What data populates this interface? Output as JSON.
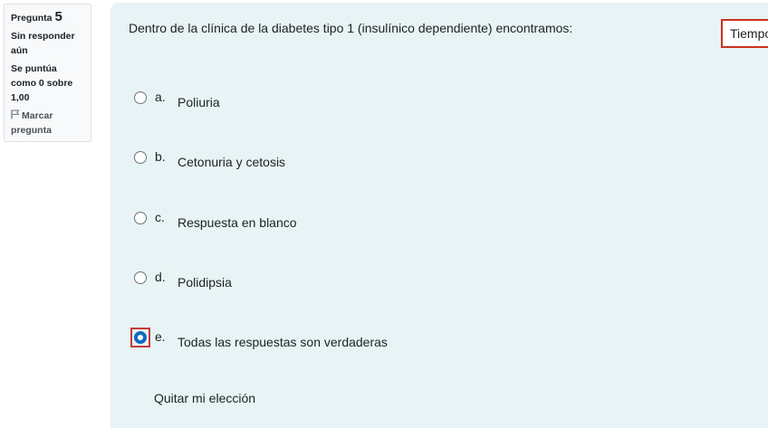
{
  "info": {
    "question_label": "Pregunta",
    "question_number": "5",
    "state": "Sin responder aún",
    "grade": "Se puntúa como 0 sobre 1,00",
    "flag_label": "Marcar pregunta"
  },
  "question": {
    "text": "Dentro de la clínica de la diabetes tipo 1 (insulínico dependiente) encontramos:"
  },
  "timer": {
    "label": "Tiempo"
  },
  "options": [
    {
      "letter": "a.",
      "text": "Poliuria",
      "selected": false
    },
    {
      "letter": "b.",
      "text": "Cetonuria y cetosis",
      "selected": false
    },
    {
      "letter": "c.",
      "text": "Respuesta en blanco",
      "selected": false
    },
    {
      "letter": "d.",
      "text": "Polidipsia",
      "selected": false
    },
    {
      "letter": "e.",
      "text": "Todas las respuestas son verdaderas",
      "selected": true
    }
  ],
  "clear_choice": "Quitar mi elección",
  "colors": {
    "panel_bg": "#e7f3f5",
    "radio_selected": "#0f6cbf",
    "timer_border": "#ca3120",
    "focus_outline": "#c83a3a"
  },
  "icons": {
    "flag": "flag-icon"
  }
}
